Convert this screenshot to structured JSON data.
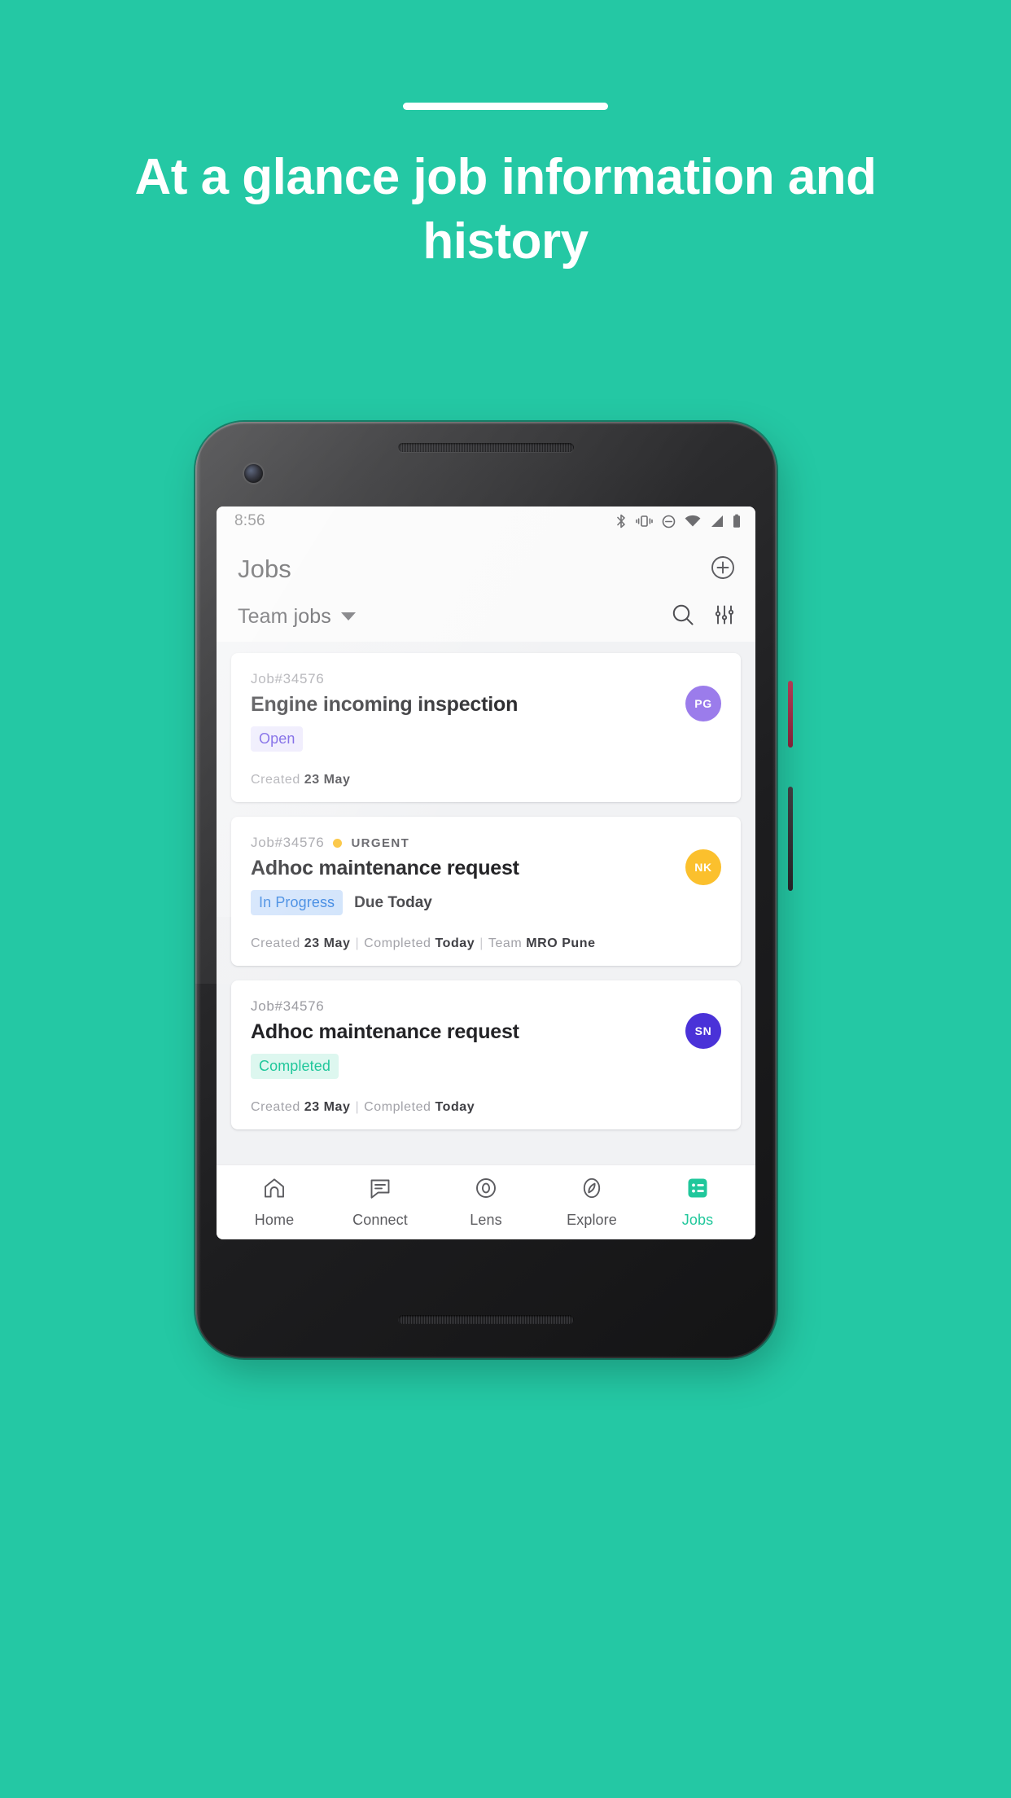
{
  "promo": {
    "headline": "At a glance job information and history",
    "background_color": "#24c8a4",
    "rule_color": "#ffffff"
  },
  "phone": {
    "status_bar": {
      "time": "8:56",
      "icons": [
        "bluetooth-icon",
        "vibrate-icon",
        "do-not-disturb-icon",
        "wifi-icon",
        "cellular-signal-icon",
        "battery-icon"
      ]
    },
    "app_bar": {
      "title": "Jobs",
      "add_button_icon": "plus-circle-icon"
    },
    "filter_bar": {
      "scope_label": "Team jobs",
      "scope_caret_icon": "chevron-down-icon",
      "search_icon": "search-icon",
      "tune_icon": "filter-tune-icon"
    },
    "jobs": [
      {
        "job_id": "Job#34576",
        "priority": "",
        "title": "Engine incoming inspection",
        "status": "Open",
        "status_style": "chip-open",
        "due": "",
        "avatar_initials": "PG",
        "avatar_color": "#9b7ceb",
        "footer": [
          {
            "label": "Created",
            "value": "23 May"
          }
        ]
      },
      {
        "job_id": "Job#34576",
        "priority": "URGENT",
        "title": "Adhoc maintenance request",
        "status": "In Progress",
        "status_style": "chip-progress",
        "due": "Due Today",
        "avatar_initials": "NK",
        "avatar_color": "#fbc02d",
        "footer": [
          {
            "label": "Created",
            "value": "23 May"
          },
          {
            "label": "Completed",
            "value": "Today"
          },
          {
            "label": "Team",
            "value": "MRO Pune"
          }
        ]
      },
      {
        "job_id": "Job#34576",
        "priority": "",
        "title": "Adhoc maintenance request",
        "status": "Completed",
        "status_style": "chip-completed",
        "due": "",
        "avatar_initials": "SN",
        "avatar_color": "#4a32d8",
        "footer": [
          {
            "label": "Created",
            "value": "23 May"
          },
          {
            "label": "Completed",
            "value": "Today"
          }
        ]
      }
    ],
    "bottom_nav": {
      "active_color": "#20c79b",
      "items": [
        {
          "label": "Home",
          "icon": "home-icon",
          "active": false
        },
        {
          "label": "Connect",
          "icon": "chat-icon",
          "active": false
        },
        {
          "label": "Lens",
          "icon": "lens-icon",
          "active": false
        },
        {
          "label": "Explore",
          "icon": "compass-icon",
          "active": false
        },
        {
          "label": "Jobs",
          "icon": "list-icon",
          "active": true
        }
      ]
    }
  }
}
